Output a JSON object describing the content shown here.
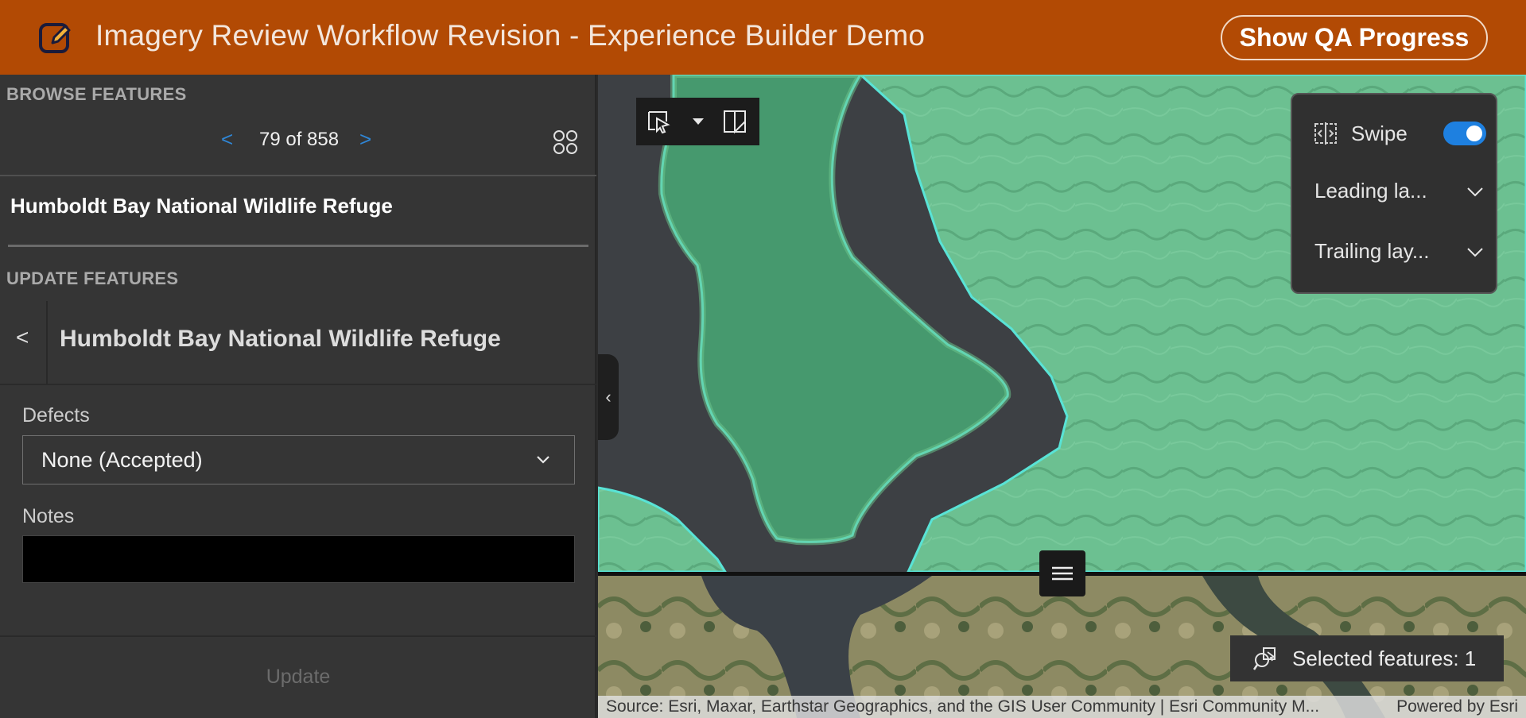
{
  "header": {
    "title": "Imagery Review Workflow Revision - Experience Builder Demo",
    "qa_button": "Show QA Progress",
    "logo_icon": "edit-icon",
    "bg_color": "#b24a04"
  },
  "browse": {
    "section_label": "BROWSE FEATURES",
    "prev": "<",
    "next": ">",
    "counter": "79 of 858",
    "feature_title": "Humboldt Bay National Wildlife Refuge",
    "grid_icon": "grid-icon"
  },
  "update": {
    "section_label": "UPDATE FEATURES",
    "back": "<",
    "feature_title": "Humboldt Bay National Wildlife Refuge",
    "defects_label": "Defects",
    "defects_value": "None (Accepted)",
    "notes_label": "Notes",
    "notes_value": "",
    "update_button": "Update"
  },
  "map": {
    "collapse_icon": "chevron-left-icon",
    "tools": [
      "select-icon",
      "caret-down-icon",
      "select-box-icon"
    ],
    "swipe": {
      "label": "Swipe",
      "enabled": true,
      "leading_layer": "Leading la...",
      "trailing_layer": "Trailing lay..."
    },
    "swipe_handle_icon": "menu-icon",
    "selected_features": "Selected features: 1",
    "attribution": "Source: Esri, Maxar, Earthstar Geographics, and the GIS User Community | Esri Community M...",
    "powered_by": "Powered by Esri",
    "accent_color": "#1e80e0"
  }
}
